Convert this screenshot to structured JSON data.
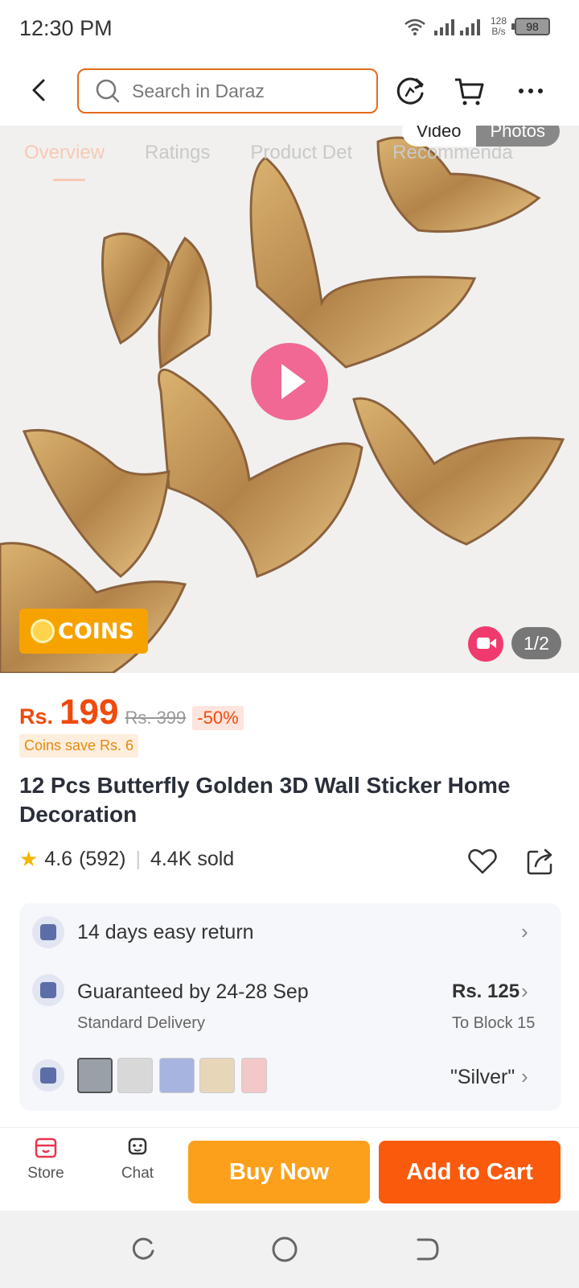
{
  "status_bar": {
    "time": "12:30 PM",
    "net_speed_value": "128",
    "net_speed_unit": "B/s",
    "battery": "98"
  },
  "nav": {
    "search_placeholder": "Search in Daraz"
  },
  "media": {
    "tabs": [
      "Overview",
      "Ratings",
      "Product Det",
      "Recommenda"
    ],
    "toggle_video": "Video",
    "toggle_photos": "Photos",
    "coins_badge": "COINS",
    "counter": "1/2"
  },
  "price": {
    "currency": "Rs.",
    "current": "199",
    "original": "Rs. 399",
    "discount": "-50%",
    "coins_save": "Coins save Rs. 6"
  },
  "product": {
    "title": "12 Pcs Butterfly Golden 3D Wall Sticker Home Decoration",
    "rating": "4.6",
    "reviews": "(592)",
    "sold": "4.4K sold"
  },
  "info": {
    "returns": "14 days easy return",
    "delivery_title": "Guaranteed by 24-28 Sep",
    "delivery_type": "Standard Delivery",
    "delivery_price": "Rs. 125",
    "delivery_location": "To Block 15",
    "variant": "\"Silver\""
  },
  "bottom_bar": {
    "store_label": "Store",
    "chat_label": "Chat",
    "buy_now": "Buy Now",
    "add_to_cart": "Add to Cart"
  },
  "colors": {
    "accent": "#f04a0c",
    "buy_now": "#fca01c",
    "add_to_cart": "#fa5a0c",
    "search_border": "#e46a1d"
  }
}
